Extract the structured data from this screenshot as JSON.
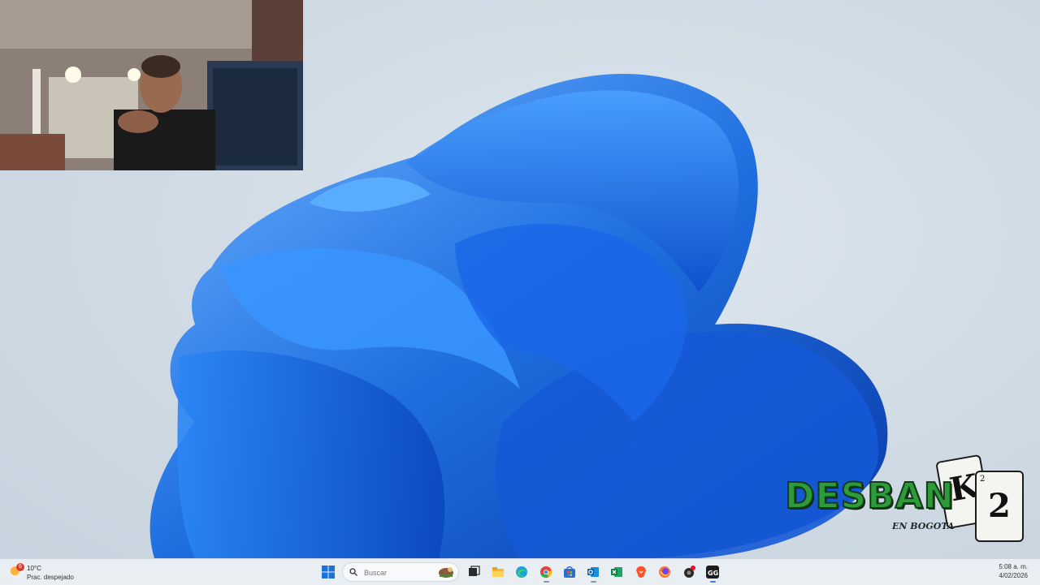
{
  "taskbar": {
    "weather": {
      "temp": "10°C",
      "desc": "Prac. despejado",
      "badge": "6"
    },
    "search": {
      "placeholder": "Buscar"
    },
    "apps": [
      {
        "name": "task-view-icon"
      },
      {
        "name": "file-explorer-icon"
      },
      {
        "name": "edge-icon"
      },
      {
        "name": "chrome-icon"
      },
      {
        "name": "store-icon"
      },
      {
        "name": "outlook-icon"
      },
      {
        "name": "excel-icon"
      },
      {
        "name": "brave-icon"
      },
      {
        "name": "firefox-icon"
      },
      {
        "name": "app-record-icon"
      },
      {
        "name": "gg-app-icon"
      }
    ],
    "clock": {
      "time": "5:08 a. m.",
      "date": "4/02/2026"
    }
  },
  "watermark": {
    "title": "DESBAN",
    "subtitle": "EN BOGOTA",
    "card1": "K",
    "card2": "2"
  },
  "colors": {
    "wallpaper_blue": "#1f6fe0",
    "taskbar_bg": "#e9eef3",
    "watermark_green": "#2e9b3a"
  }
}
